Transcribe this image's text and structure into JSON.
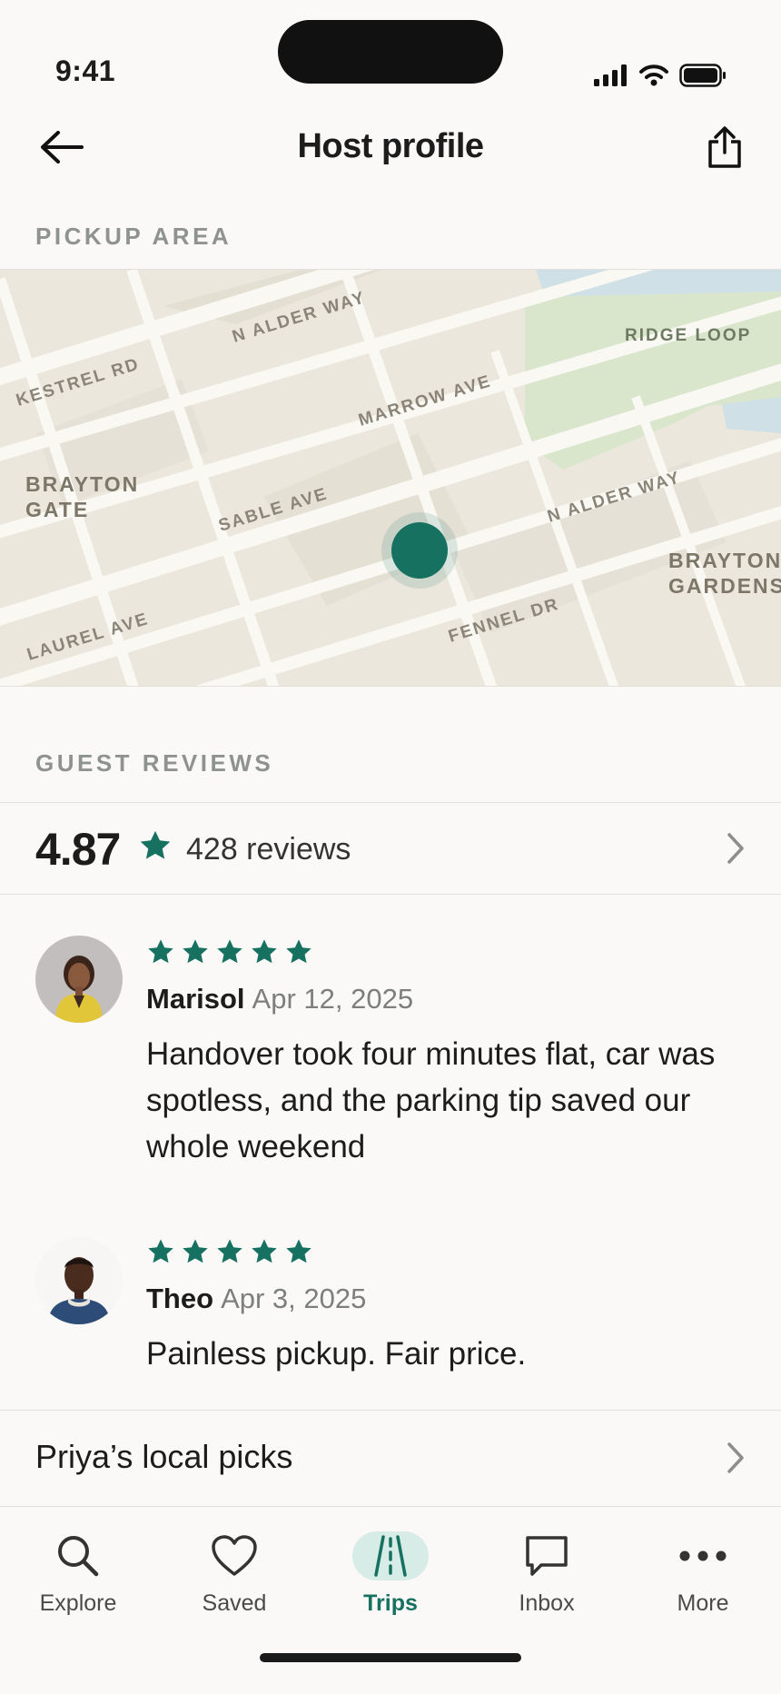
{
  "status_bar": {
    "time": "9:41"
  },
  "header": {
    "title": "Host profile",
    "back_icon": "arrow-left-icon",
    "share_icon": "share-icon"
  },
  "pickup": {
    "section_label": "PICKUP AREA",
    "map_labels": {
      "n_alder_way_1": "N ALDER WAY",
      "kestrel_rd": "KESTREL RD",
      "ridge_loop": "RIDGE LOOP",
      "marrow_ave": "MARROW AVE",
      "brayton_gate_1": "BRAYTON",
      "brayton_gate_2": "GATE",
      "sable_ave": "SABLE AVE",
      "n_alder_way_2": "N ALDER WAY",
      "brayton_gardens_1": "BRAYTON",
      "brayton_gardens_2": "GARDENS",
      "fennel_dr": "FENNEL DR",
      "laurel_ave": "LAUREL AVE"
    }
  },
  "reviews": {
    "section_label": "GUEST REVIEWS",
    "rating": "4.87",
    "count_label": "428 reviews",
    "items": [
      {
        "name": "Marisol",
        "date": "Apr 12, 2025",
        "stars": 5,
        "text": "Handover took four minutes flat, car was spotless, and the parking tip saved our whole weekend"
      },
      {
        "name": "Theo",
        "date": "Apr 3, 2025",
        "stars": 5,
        "text": "Painless pickup. Fair price."
      }
    ]
  },
  "picks": {
    "label": "Priya’s local picks"
  },
  "tabbar": {
    "items": [
      {
        "label": "Explore",
        "icon": "search-icon"
      },
      {
        "label": "Saved",
        "icon": "heart-icon"
      },
      {
        "label": "Trips",
        "icon": "road-icon",
        "active": true
      },
      {
        "label": "Inbox",
        "icon": "chat-bubble-icon"
      },
      {
        "label": "More",
        "icon": "more-dots-icon"
      }
    ]
  },
  "colors": {
    "accent": "#167160",
    "background": "#faf9f7",
    "map_land": "#ece7dc",
    "map_park": "#d9e6cc",
    "map_water": "#cfe0e6"
  }
}
